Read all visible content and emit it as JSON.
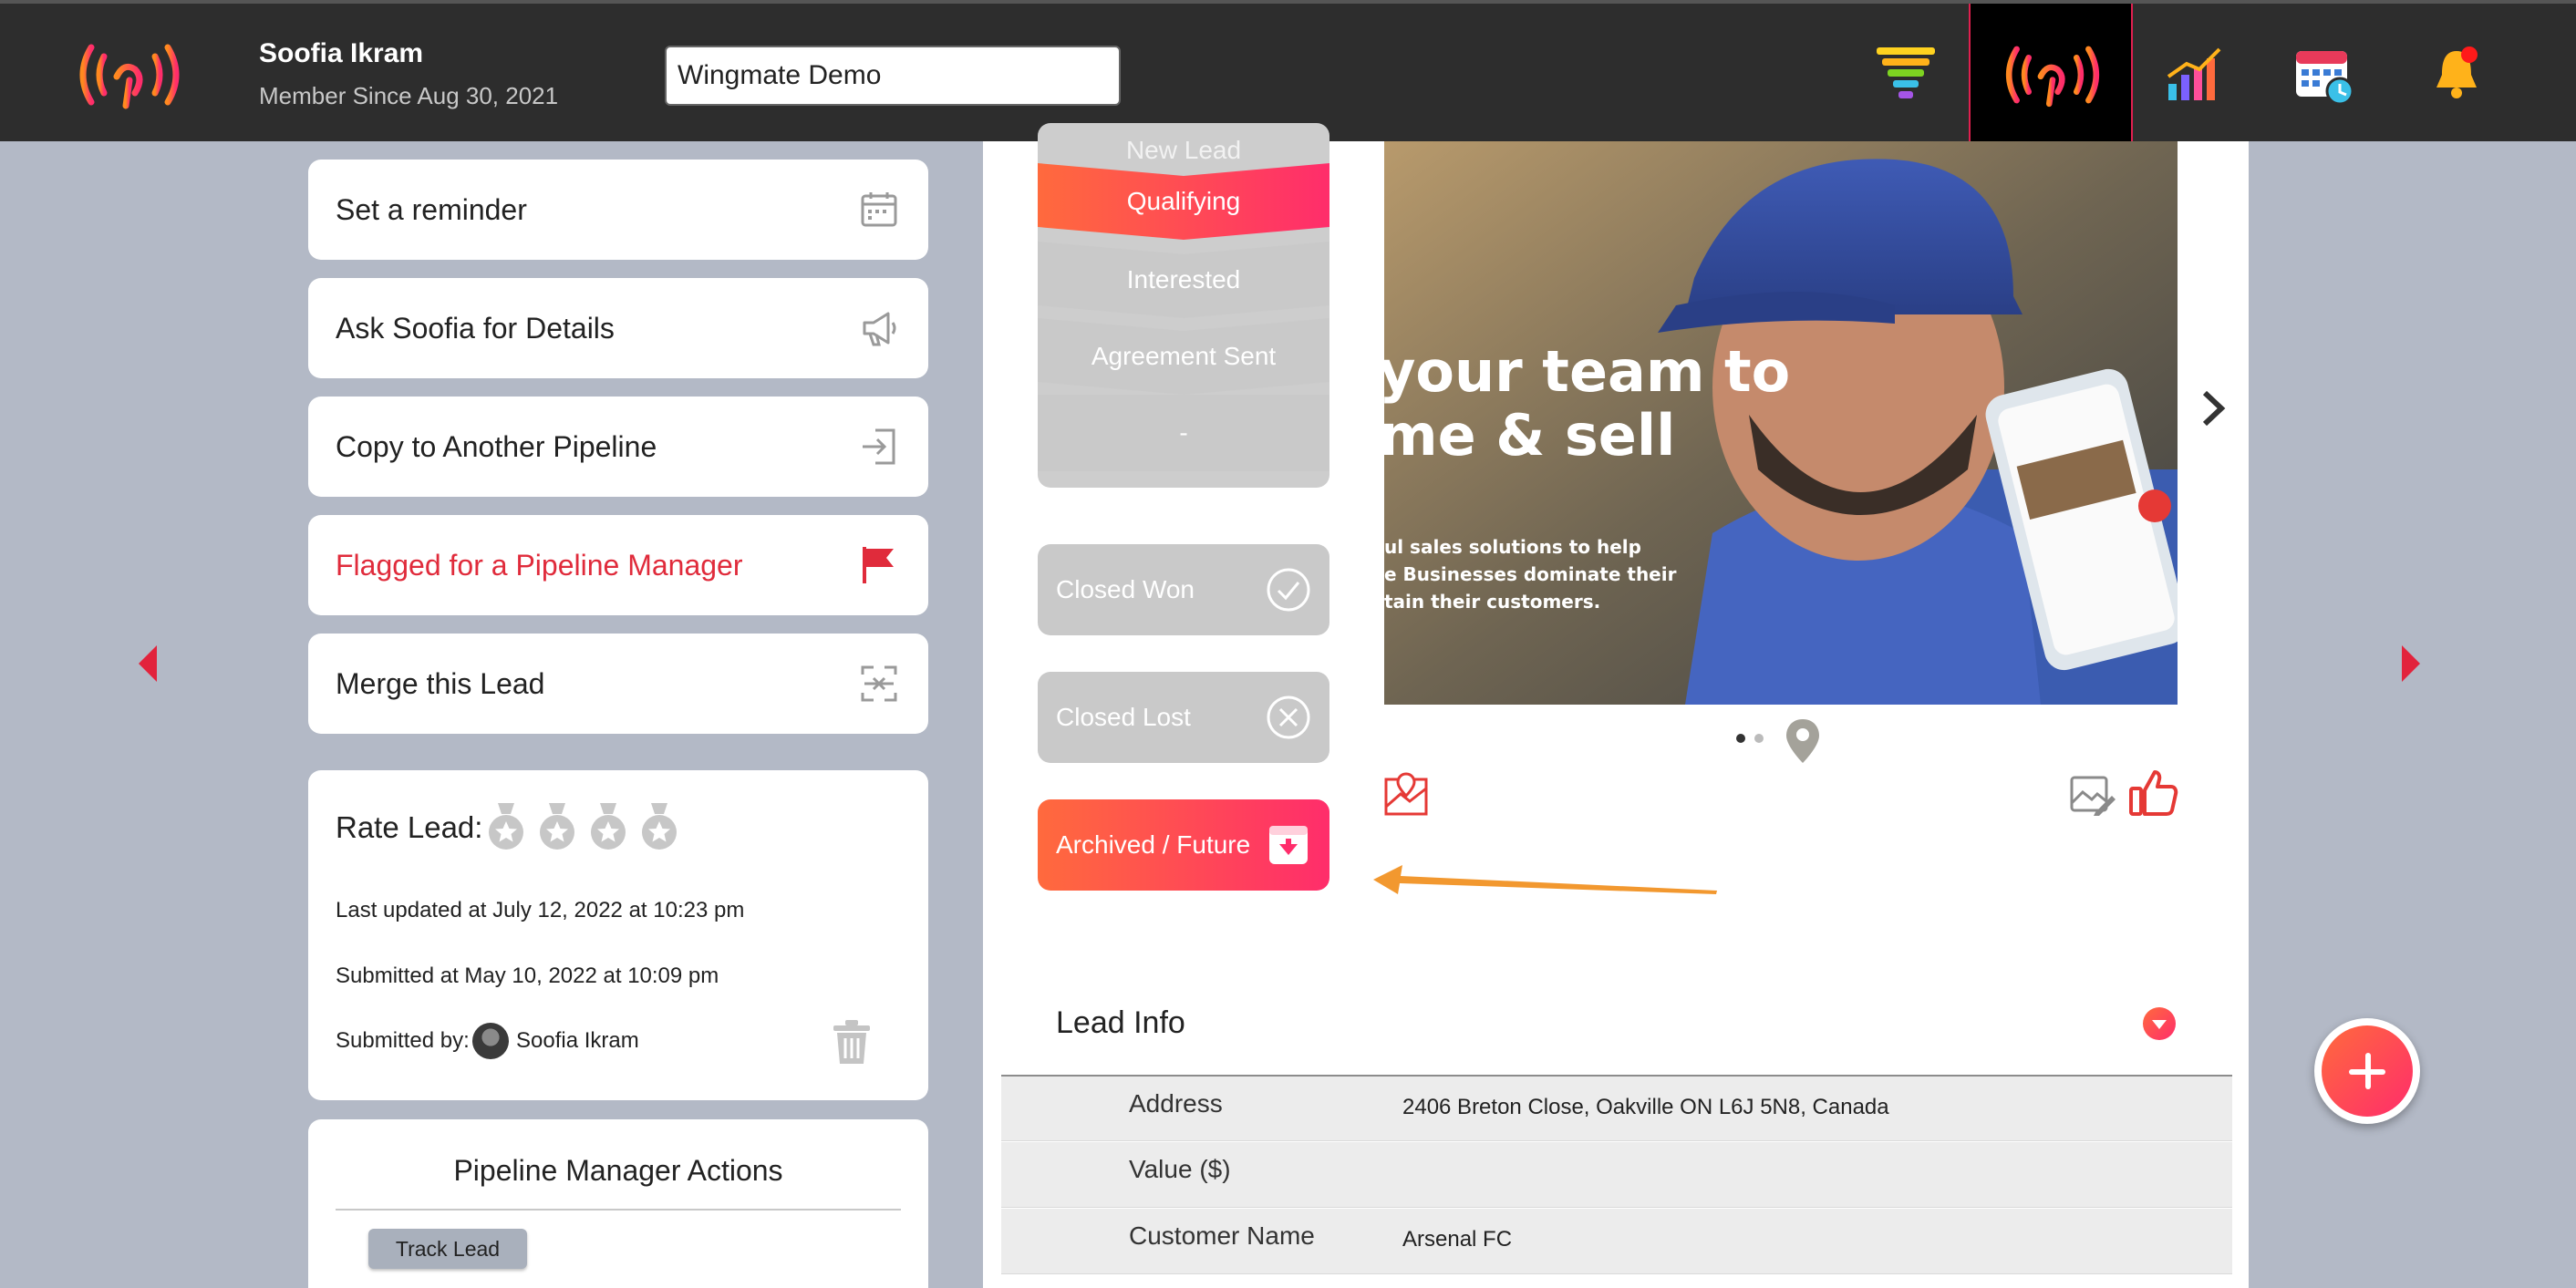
{
  "header": {
    "user_name": "Soofia Ikram",
    "member_since": "Member Since Aug 30, 2021",
    "pipeline_name": "Wingmate Demo",
    "nav_icons": [
      "funnel-icon",
      "broadcast-icon",
      "chart-icon",
      "calendar-icon",
      "bell-icon"
    ]
  },
  "actions": {
    "set_reminder": "Set a reminder",
    "ask_details": "Ask Soofia for Details",
    "copy_pipeline": "Copy to Another Pipeline",
    "flagged": "Flagged for a Pipeline Manager",
    "merge": "Merge this Lead"
  },
  "rating": {
    "label": "Rate Lead:",
    "last_updated": "Last updated at July 12, 2022 at 10:23 pm",
    "submitted_at": "Submitted at May 10, 2022 at 10:09 pm",
    "submitted_by_label": "Submitted by:",
    "submitted_by": "Soofia Ikram",
    "stars": 0,
    "max_stars": 4
  },
  "pipeline_manager": {
    "title": "Pipeline Manager Actions",
    "track_button": "Track Lead"
  },
  "stages": {
    "new_lead": "New Lead",
    "qualifying": "Qualifying",
    "interested": "Interested",
    "agreement_sent": "Agreement Sent",
    "dash": "-",
    "active": "Qualifying"
  },
  "status_buttons": {
    "closed_won": "Closed Won",
    "closed_lost": "Closed Lost",
    "archived": "Archived / Future"
  },
  "photo": {
    "overlay_line1": "your team to",
    "overlay_line2": "me & sell",
    "overlay_small1": "ul sales solutions to help",
    "overlay_small2": "e Businesses dominate their",
    "overlay_small3": "tain their customers.",
    "dots_total": 2,
    "dots_active": 1
  },
  "lead_info": {
    "title": "Lead Info",
    "rows": [
      {
        "key": "Address",
        "value": "2406 Breton Close, Oakville ON L6J 5N8, Canada"
      },
      {
        "key": "Value ($)",
        "value": ""
      },
      {
        "key": "Customer Name",
        "value": "Arsenal FC"
      }
    ]
  },
  "colors": {
    "accent_start": "#ff6a3d",
    "accent_end": "#ff2d6b",
    "flag_red": "#e02b3b",
    "annotation_arrow": "#f2982f",
    "topbar": "#2d2d2d",
    "page_bg": "#b3b9c6"
  }
}
